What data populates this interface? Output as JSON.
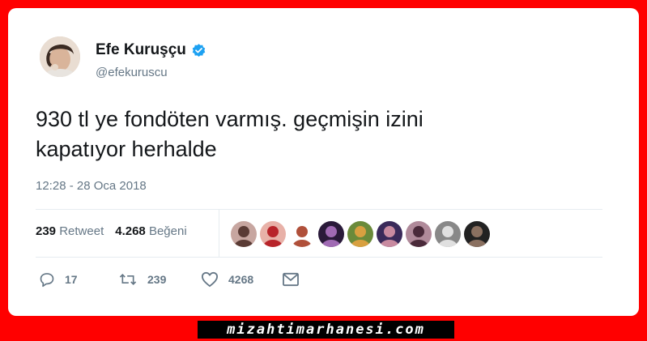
{
  "user": {
    "display_name": "Efe Kuruşçu",
    "handle": "@efekuruscu",
    "verified_icon": "verified-badge-icon",
    "verified_color": "#1da1f2"
  },
  "tweet": {
    "lines": [
      "930 tl ye fondöten varmış. geçmişin izini",
      "kapatıyor herhalde"
    ],
    "timestamp": "12:28 - 28 Oca 2018"
  },
  "stats": {
    "retweet_count": "239",
    "retweet_label": "Retweet",
    "like_count": "4.268",
    "like_label": "Beğeni",
    "liker_avatars": [
      {
        "bg": "#c7a6a0",
        "fg": "#5a3b35"
      },
      {
        "bg": "#e8b1a8",
        "fg": "#b8242a"
      },
      {
        "bg": "#ffffff",
        "fg": "#b0503a"
      },
      {
        "bg": "#2a1a3a",
        "fg": "#a06ab4"
      },
      {
        "bg": "#6a8a3a",
        "fg": "#d8a040"
      },
      {
        "bg": "#3a2a5a",
        "fg": "#c88aa0"
      },
      {
        "bg": "#b08a9a",
        "fg": "#4a2a3a"
      },
      {
        "bg": "#888888",
        "fg": "#e0e0e0"
      },
      {
        "bg": "#222222",
        "fg": "#8a7060"
      }
    ]
  },
  "actions": {
    "reply_icon": "reply-icon",
    "reply_count": "17",
    "retweet_icon": "retweet-icon",
    "retweet_count": "239",
    "like_icon": "heart-icon",
    "like_count": "4268",
    "dm_icon": "envelope-icon"
  },
  "watermark": "mizahtimarhanesi.com",
  "colors": {
    "frame": "#ff0000",
    "text_primary": "#14171a",
    "text_secondary": "#657786"
  }
}
